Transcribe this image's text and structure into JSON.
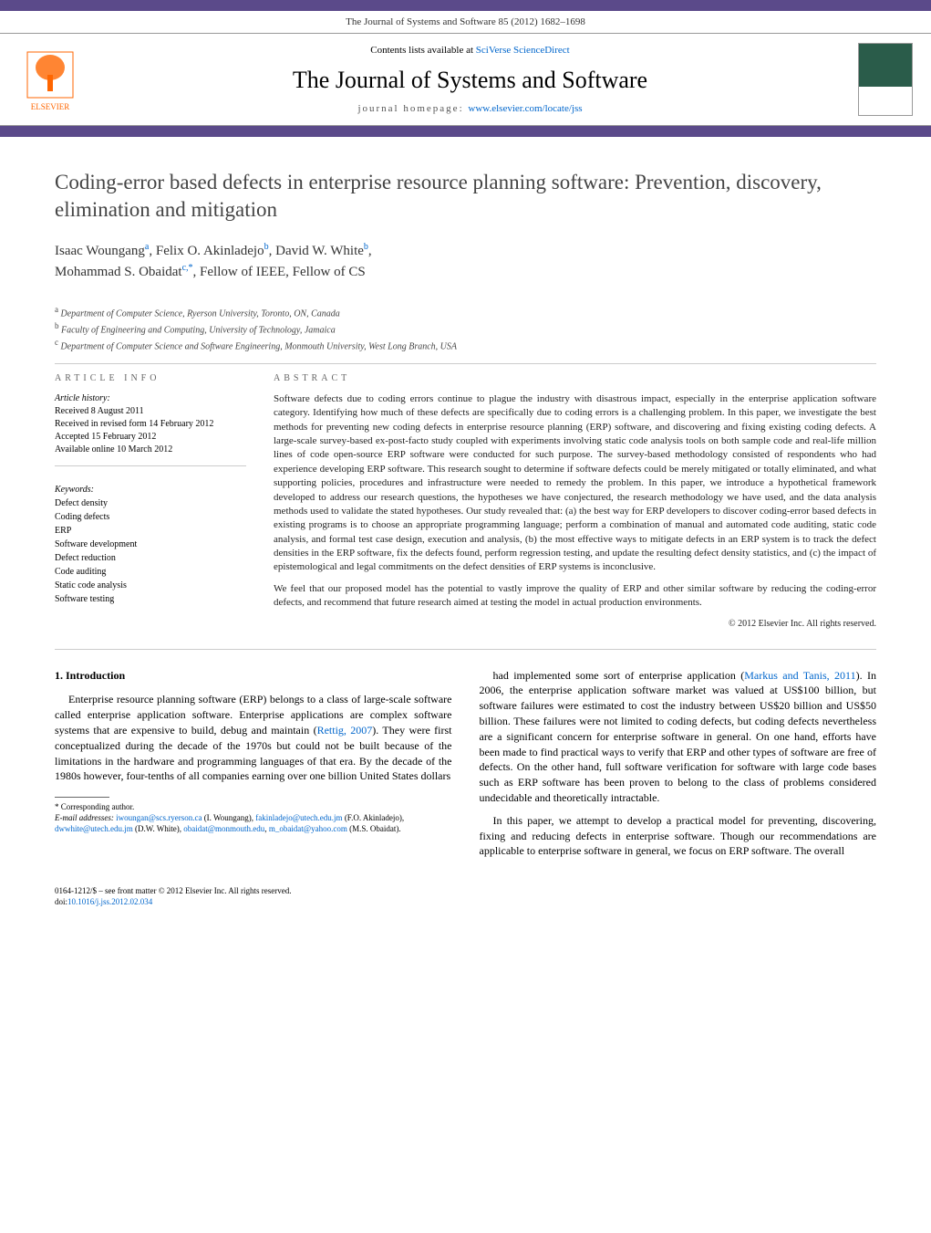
{
  "journal_ref": "The Journal of Systems and Software 85 (2012) 1682–1698",
  "banner": {
    "contents_prefix": "Contents lists available at ",
    "contents_link": "SciVerse ScienceDirect",
    "journal_name": "The Journal of Systems and Software",
    "homepage_prefix": "journal homepage: ",
    "homepage_link": "www.elsevier.com/locate/jss",
    "publisher": "ELSEVIER"
  },
  "title": "Coding-error based defects in enterprise resource planning software: Prevention, discovery, elimination and mitigation",
  "authors": [
    {
      "name": "Isaac Woungang",
      "aff": "a"
    },
    {
      "name": "Felix O. Akinladejo",
      "aff": "b"
    },
    {
      "name": "David W. White",
      "aff": "b"
    },
    {
      "name": "Mohammad S. Obaidat",
      "aff": "c,*",
      "fellow": ", Fellow of IEEE, Fellow of CS"
    }
  ],
  "affiliations": {
    "a": "Department of Computer Science, Ryerson University, Toronto, ON, Canada",
    "b": "Faculty of Engineering and Computing, University of Technology, Jamaica",
    "c": "Department of Computer Science and Software Engineering, Monmouth University, West Long Branch, USA"
  },
  "article_info": {
    "heading": "article info",
    "history_label": "Article history:",
    "history": [
      "Received 8 August 2011",
      "Received in revised form 14 February 2012",
      "Accepted 15 February 2012",
      "Available online 10 March 2012"
    ],
    "keywords_label": "Keywords:",
    "keywords": [
      "Defect density",
      "Coding defects",
      "ERP",
      "Software development",
      "Defect reduction",
      "Code auditing",
      "Static code analysis",
      "Software testing"
    ]
  },
  "abstract": {
    "heading": "abstract",
    "p1": "Software defects due to coding errors continue to plague the industry with disastrous impact, especially in the enterprise application software category. Identifying how much of these defects are specifically due to coding errors is a challenging problem. In this paper, we investigate the best methods for preventing new coding defects in enterprise resource planning (ERP) software, and discovering and fixing existing coding defects. A large-scale survey-based ex-post-facto study coupled with experiments involving static code analysis tools on both sample code and real-life million lines of code open-source ERP software were conducted for such purpose. The survey-based methodology consisted of respondents who had experience developing ERP software. This research sought to determine if software defects could be merely mitigated or totally eliminated, and what supporting policies, procedures and infrastructure were needed to remedy the problem. In this paper, we introduce a hypothetical framework developed to address our research questions, the hypotheses we have conjectured, the research methodology we have used, and the data analysis methods used to validate the stated hypotheses. Our study revealed that: (a) the best way for ERP developers to discover coding-error based defects in existing programs is to choose an appropriate programming language; perform a combination of manual and automated code auditing, static code analysis, and formal test case design, execution and analysis, (b) the most effective ways to mitigate defects in an ERP system is to track the defect densities in the ERP software, fix the defects found, perform regression testing, and update the resulting defect density statistics, and (c) the impact of epistemological and legal commitments on the defect densities of ERP systems is inconclusive.",
    "p2": "We feel that our proposed model has the potential to vastly improve the quality of ERP and other similar software by reducing the coding-error defects, and recommend that future research aimed at testing the model in actual production environments.",
    "copyright": "© 2012 Elsevier Inc. All rights reserved."
  },
  "body": {
    "heading": "1. Introduction",
    "p1_a": "Enterprise resource planning software (ERP) belongs to a class of large-scale software called enterprise application software. Enterprise applications are complex software systems that are expensive to build, debug and maintain (",
    "p1_cite1": "Rettig, 2007",
    "p1_b": "). They were first conceptualized during the decade of the 1970s but could not be built because of the limitations in the hardware and programming languages of that era. By the decade of the 1980s however, four-tenths of all companies earning over one billion United States dollars ",
    "p2_a": "had implemented some sort of enterprise application (",
    "p2_cite1": "Markus and Tanis, 2011",
    "p2_b": "). In 2006, the enterprise application software market was valued at US$100 billion, but software failures were estimated to cost the industry between US$20 billion and US$50 billion. These failures were not limited to coding defects, but coding defects nevertheless are a significant concern for enterprise software in general. On one hand, efforts have been made to find practical ways to verify that ERP and other types of software are free of defects. On the other hand, full software verification for software with large code bases such as ERP software has been proven to belong to the class of problems considered undecidable and theoretically intractable.",
    "p3": "In this paper, we attempt to develop a practical model for preventing, discovering, fixing and reducing defects in enterprise software. Though our recommendations are applicable to enterprise software in general, we focus on ERP software. The overall"
  },
  "footnotes": {
    "corresponding": "Corresponding author.",
    "email_label": "E-mail addresses:",
    "emails": [
      {
        "addr": "iwoungan@scs.ryerson.ca",
        "who": "(I. Woungang)"
      },
      {
        "addr": "fakinladejo@utech.edu.jm",
        "who": "(F.O. Akinladejo)"
      },
      {
        "addr": "dwwhite@utech.edu.jm",
        "who": "(D.W. White)"
      },
      {
        "addr": "obaidat@monmouth.edu",
        "who": ""
      },
      {
        "addr": "m_obaidat@yahoo.com",
        "who": "(M.S. Obaidat)"
      }
    ]
  },
  "footer": {
    "line1": "0164-1212/$ – see front matter © 2012 Elsevier Inc. All rights reserved.",
    "doi_prefix": "doi:",
    "doi": "10.1016/j.jss.2012.02.034"
  }
}
